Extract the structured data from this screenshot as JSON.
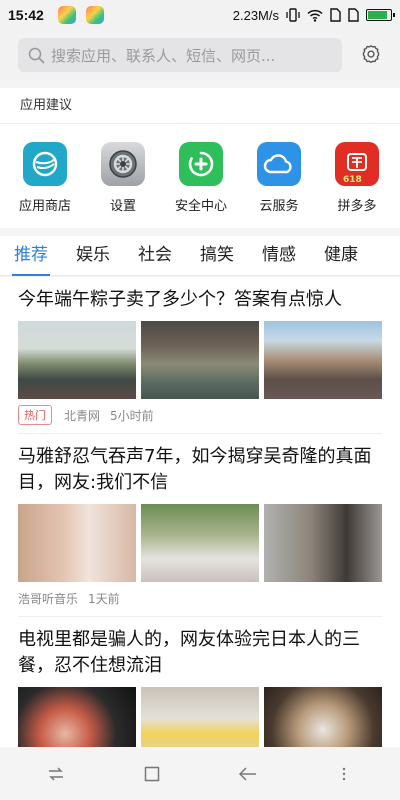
{
  "status_bar": {
    "time": "15:42",
    "network_speed": "2.23M/s",
    "icons": [
      "vibrate-icon",
      "wifi-icon",
      "sim-icon",
      "signal-icon",
      "battery-icon"
    ],
    "battery_level": 0.85
  },
  "search": {
    "placeholder": "搜索应用、联系人、短信、网页..."
  },
  "suggestions": {
    "title": "应用建议",
    "apps": [
      {
        "label": "应用商店",
        "icon": "app-store-icon",
        "color": "#21a8c9"
      },
      {
        "label": "设置",
        "icon": "settings-icon",
        "color": "#8e9295"
      },
      {
        "label": "安全中心",
        "icon": "security-center-icon",
        "color": "#2fbf5a"
      },
      {
        "label": "云服务",
        "icon": "cloud-icon",
        "color": "#2e93e6"
      },
      {
        "label": "拼多多",
        "icon": "pinduoduo-icon",
        "color": "#e02e24",
        "badge": "618"
      }
    ]
  },
  "tabs": [
    "推荐",
    "娱乐",
    "社会",
    "搞笑",
    "情感",
    "健康"
  ],
  "active_tab": "推荐",
  "articles": [
    {
      "title": "今年端午粽子卖了多少个？答案有点惊人",
      "hot_label": "热门",
      "source": "北青网",
      "time": "5小时前"
    },
    {
      "title": "马雅舒忍气吞声7年，如今揭穿吴奇隆的真面目，网友:我们不信",
      "source": "浩哥听音乐",
      "time": "1天前"
    },
    {
      "title": "电视里都是骗人的，网友体验完日本人的三餐，忍不住想流泪"
    }
  ],
  "colors": {
    "accent": "#2f7fdb",
    "hot": "#e35a5a"
  }
}
